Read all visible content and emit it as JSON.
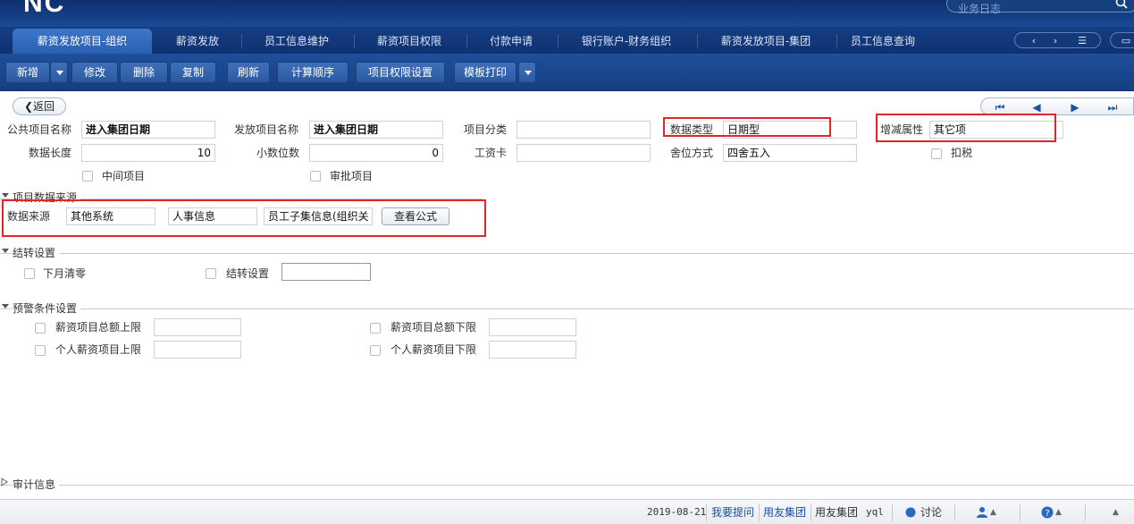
{
  "header": {
    "logo": "NC",
    "search_placeholder": "业务日志"
  },
  "tabs": [
    {
      "label": "薪资发放项目-组织",
      "active": true
    },
    {
      "label": "薪资发放"
    },
    {
      "label": "员工信息维护"
    },
    {
      "label": "薪资项目权限"
    },
    {
      "label": "付款申请"
    },
    {
      "label": "银行账户-财务组织"
    },
    {
      "label": "薪资发放项目-集团"
    },
    {
      "label": "员工信息查询"
    }
  ],
  "tab_nav": {
    "prev": "‹",
    "next": "›",
    "list": "☰",
    "max": "▭"
  },
  "toolbar": {
    "add": "新增",
    "edit": "修改",
    "delete": "删除",
    "copy": "复制",
    "refresh": "刷新",
    "calc_order": "计算顺序",
    "item_permission": "项目权限设置",
    "template_print": "模板打印"
  },
  "nav": {
    "back": "返回",
    "first": "⏮",
    "prev": "◀",
    "next": "▶",
    "last": "⏭"
  },
  "form": {
    "public_item_name": {
      "label": "公共项目名称",
      "value": "进入集团日期"
    },
    "issue_item_name": {
      "label": "发放项目名称",
      "value": "进入集团日期"
    },
    "item_category": {
      "label": "项目分类",
      "value": ""
    },
    "data_type": {
      "label": "数据类型",
      "value": "日期型"
    },
    "inc_dec_attr": {
      "label": "增减属性",
      "value": "其它项"
    },
    "data_length": {
      "label": "数据长度",
      "value": "10"
    },
    "decimal_places": {
      "label": "小数位数",
      "value": "0"
    },
    "payslip": {
      "label": "工资卡",
      "value": ""
    },
    "rounding": {
      "label": "舍位方式",
      "value": "四舍五入"
    },
    "tax": {
      "label": "扣税"
    },
    "intermediate": {
      "label": "中间项目"
    },
    "approval": {
      "label": "审批项目"
    }
  },
  "data_source": {
    "section_title": "项目数据来源",
    "label": "数据来源",
    "source": "其他系统",
    "system": "人事信息",
    "subset": "员工子集信息(组织关",
    "view_formula": "查看公式"
  },
  "carry_over": {
    "section_title": "结转设置",
    "clear_next_month": "下月清零",
    "carry_setting": "结转设置",
    "carry_value": ""
  },
  "warning": {
    "section_title": "预警条件设置",
    "total_upper": "薪资项目总额上限",
    "total_lower": "薪资项目总额下限",
    "personal_upper": "个人薪资项目上限",
    "personal_lower": "个人薪资项目下限"
  },
  "audit": {
    "section_title": "审计信息"
  },
  "status": {
    "date": "2019-08-21",
    "ask": "我要提问",
    "group": "用友集团",
    "group2": "用友集团",
    "user": "yql",
    "discuss": "讨论"
  }
}
